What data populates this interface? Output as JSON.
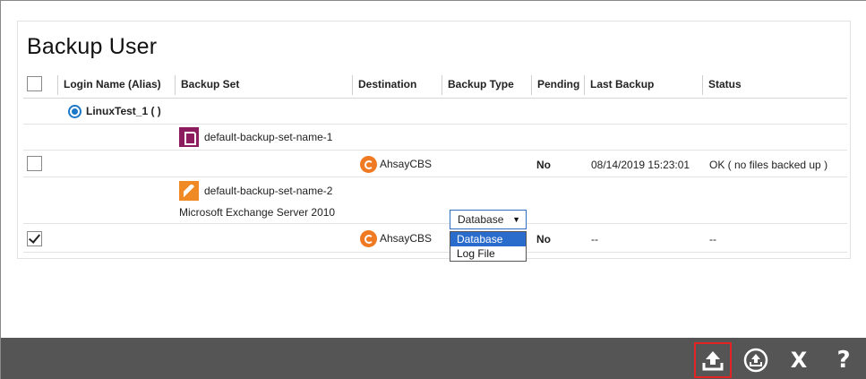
{
  "page": {
    "title": "Backup User"
  },
  "table": {
    "headers": {
      "login": "Login Name (Alias)",
      "backup_set": "Backup Set",
      "destination": "Destination",
      "backup_type": "Backup Type",
      "pending": "Pending",
      "last_backup": "Last Backup",
      "status": "Status"
    },
    "user": {
      "name": "LinuxTest_1 ( )"
    },
    "backup_sets": [
      {
        "name": "default-backup-set-name-1",
        "subtitle": "",
        "destination": "AhsayCBS",
        "pending": "No",
        "last_backup": "08/14/2019 15:23:01",
        "status": "OK ( no files backed up )",
        "checked": false
      },
      {
        "name": "default-backup-set-name-2",
        "subtitle": "Microsoft Exchange Server 2010",
        "destination": "AhsayCBS",
        "pending": "No",
        "last_backup": "--",
        "status": "--",
        "checked": true,
        "backup_type": {
          "selected": "Database",
          "options": [
            "Database",
            "Log File"
          ],
          "highlighted": "Database"
        }
      }
    ]
  },
  "toolbar": {
    "buttons": [
      {
        "icon": "backup-upload-icon",
        "highlighted": true
      },
      {
        "icon": "scheduled-backup-icon",
        "highlighted": false
      },
      {
        "icon": "close-icon",
        "glyph": "X",
        "highlighted": false
      },
      {
        "icon": "help-icon",
        "glyph": "?",
        "highlighted": false
      }
    ]
  },
  "colors": {
    "toolbar_bg": "#555555",
    "accent_blue": "#1b77c8",
    "highlight_red": "#e32424",
    "dest_orange": "#f07a22",
    "backupset_magenta": "#8c1c5e",
    "exchange_orange": "#f08a24",
    "dropdown_selected": "#2a6ccc"
  }
}
